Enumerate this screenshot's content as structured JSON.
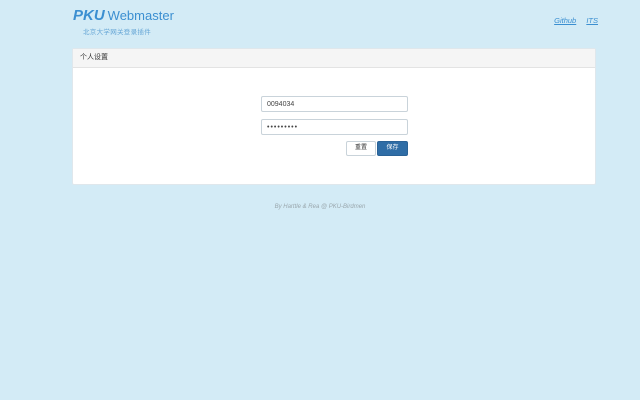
{
  "brand": {
    "name_main": "PKU",
    "name_sub": "Webmaster",
    "tagline": "北京大学网关登录插件"
  },
  "toplinks": {
    "github": "Github",
    "its": "ITS"
  },
  "settings": {
    "title": "个人设置",
    "username_value": "0094034",
    "password_value": "•••••••••",
    "reset_label": "重置",
    "save_label": "保存"
  },
  "footer": {
    "text": "By Harttle & Rea @ PKU-Birdmen"
  }
}
